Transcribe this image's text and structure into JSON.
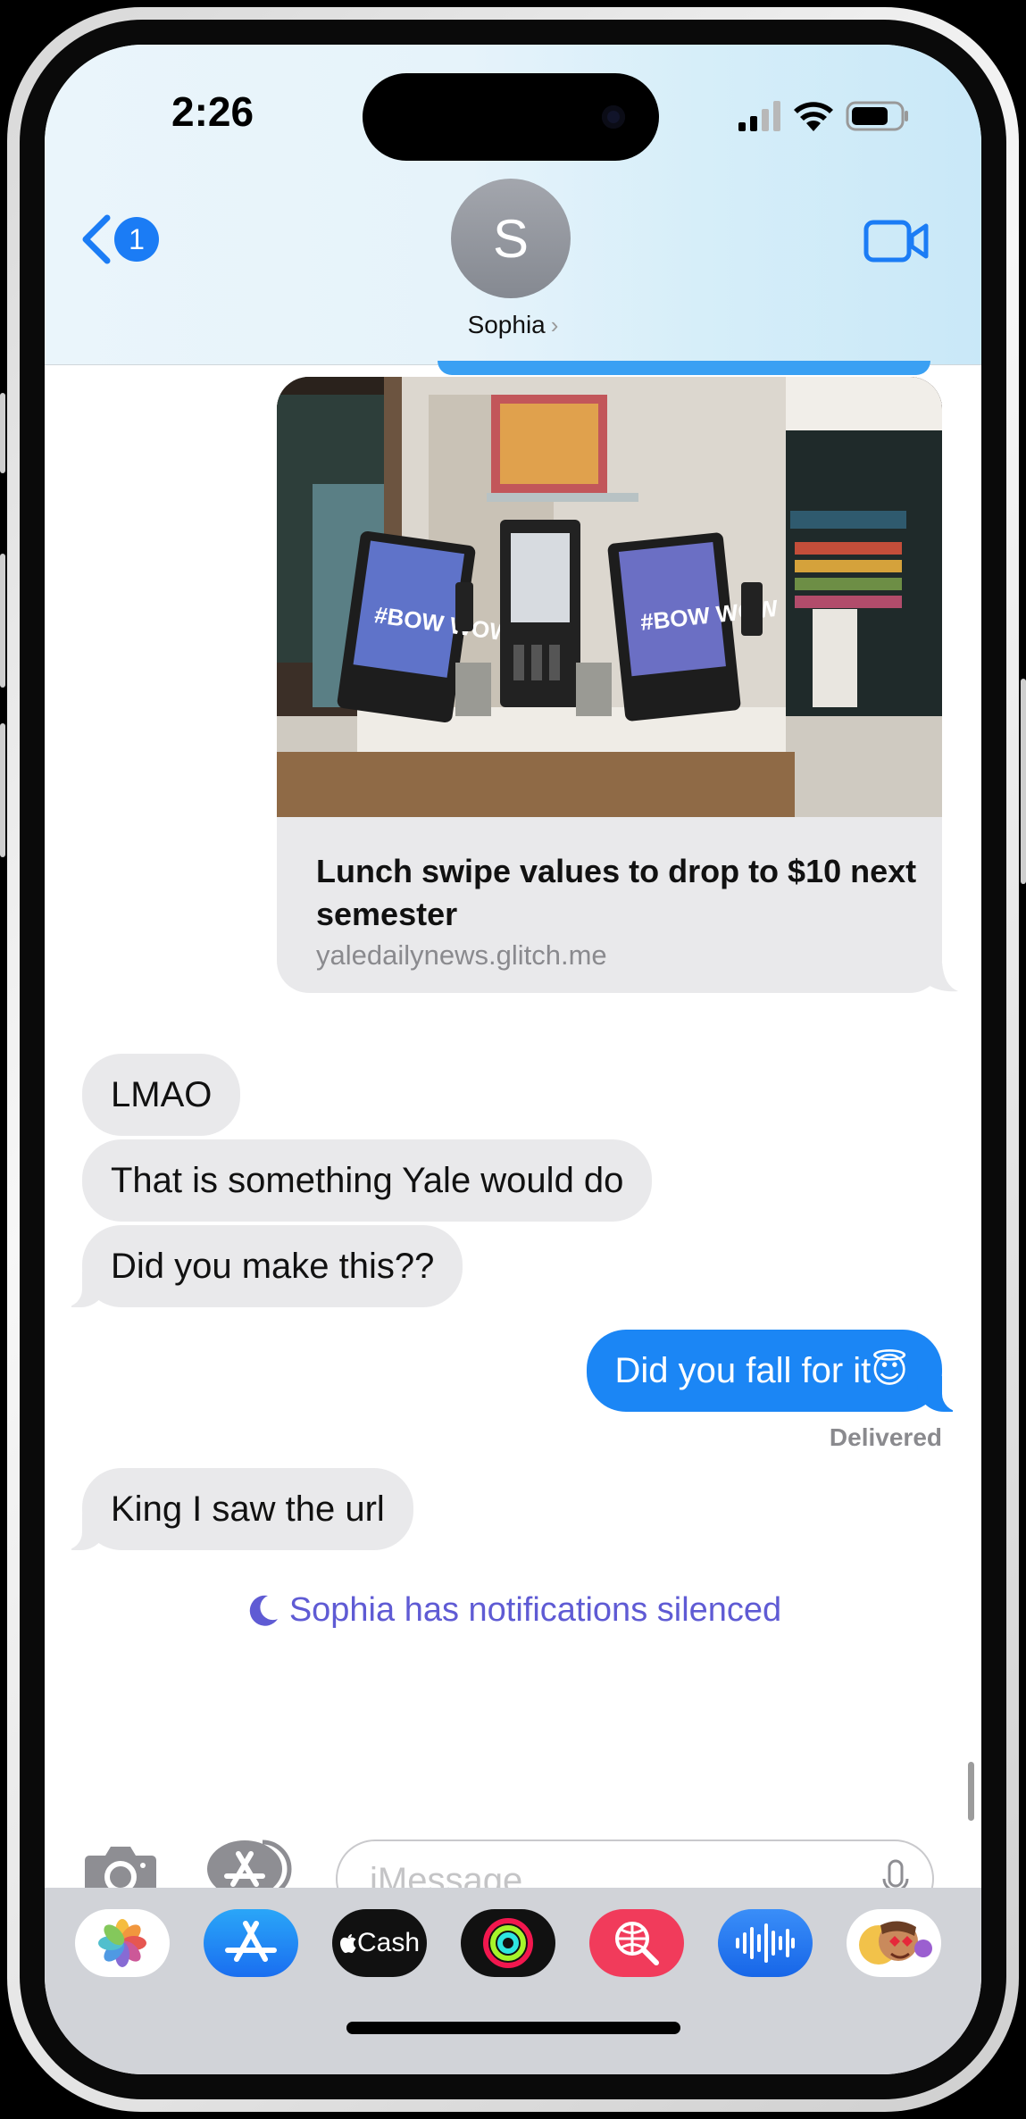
{
  "status_bar": {
    "time": "2:26"
  },
  "header": {
    "back_badge": "1",
    "avatar_initial": "S",
    "contact_name": "Sophia"
  },
  "link_preview": {
    "title": "Lunch swipe values to drop to $10 next semester",
    "domain": "yaledailynews.glitch.me",
    "image_sign_text": "#BOW WOW"
  },
  "messages": [
    {
      "direction": "in",
      "text": "LMAO"
    },
    {
      "direction": "in",
      "text": "That is something Yale would do"
    },
    {
      "direction": "in",
      "text": "Did you make this??"
    },
    {
      "direction": "out",
      "text": "Did you fall for it",
      "emoji": "😇"
    },
    {
      "direction": "in",
      "text": "King I saw the url"
    }
  ],
  "delivery_status": "Delivered",
  "notice": "Sophia has notifications silenced",
  "input": {
    "placeholder": "iMessage",
    "value": ""
  },
  "app_drawer": [
    {
      "name": "photos-app",
      "label": ""
    },
    {
      "name": "app-store-app",
      "label": ""
    },
    {
      "name": "apple-cash-app",
      "label": "Cash"
    },
    {
      "name": "fitness-app",
      "label": ""
    },
    {
      "name": "images-search-app",
      "label": ""
    },
    {
      "name": "audio-message-app",
      "label": ""
    },
    {
      "name": "memoji-app",
      "label": ""
    }
  ],
  "colors": {
    "imessage_blue": "#1b86f5",
    "incoming_gray": "#e9e9eb",
    "notice_purple": "#5f5bd4",
    "ios_blue": "#1b7cf5"
  }
}
